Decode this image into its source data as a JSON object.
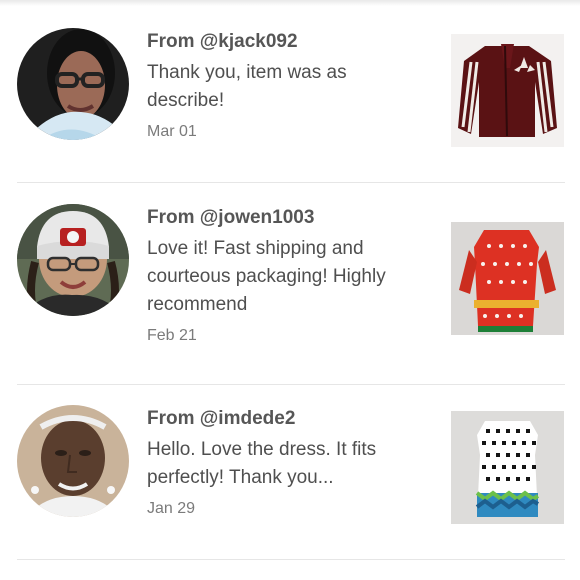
{
  "reviews": [
    {
      "username": "@kjack092",
      "from_prefix": "From ",
      "comment": "Thank you, item was as describe!",
      "date": "Mar 01",
      "avatar": "reviewer-avatar-photo",
      "item_photo": "burgundy-track-jacket-photo"
    },
    {
      "username": "@jowen1003",
      "from_prefix": "From ",
      "comment": "Love it! Fast shipping and courteous packaging! Highly recommend",
      "date": "Feb 21",
      "avatar": "reviewer-avatar-photo",
      "item_photo": "red-holiday-pattern-dress-photo"
    },
    {
      "username": "@imdede2",
      "from_prefix": "From ",
      "comment": "Hello. Love the dress. It fits perfectly! Thank you...",
      "date": "Jan 29",
      "avatar": "reviewer-avatar-photo",
      "item_photo": "patterned-shift-dress-photo"
    }
  ],
  "colors": {
    "text_primary": "#565656",
    "text_secondary": "#7b7b7b",
    "separator": "#e6e6e6",
    "background": "#ffffff"
  }
}
